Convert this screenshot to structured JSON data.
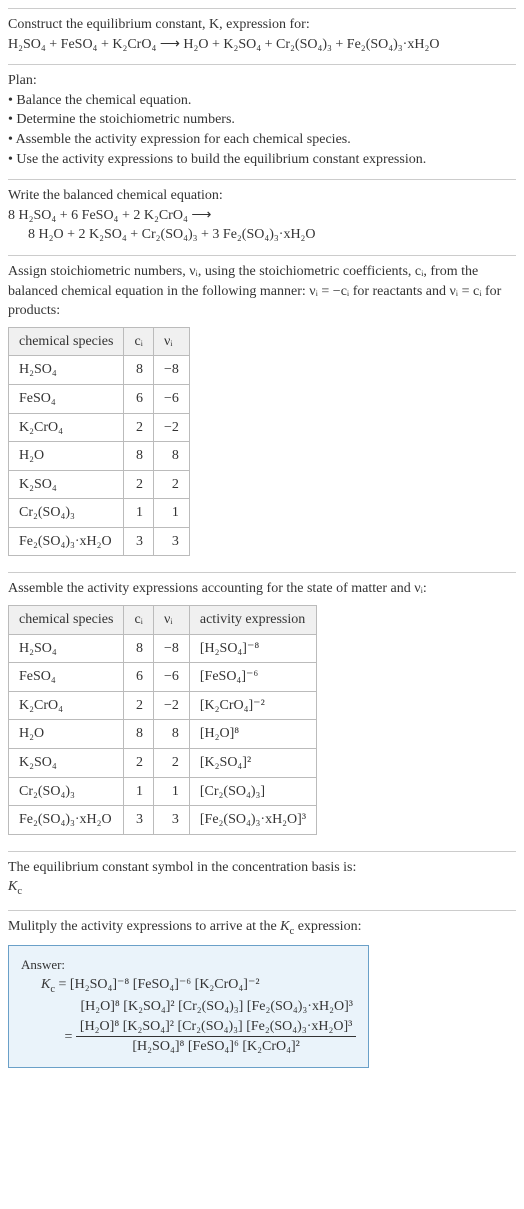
{
  "intro": {
    "line1": "Construct the equilibrium constant, K, expression for:",
    "equation": "H₂SO₄ + FeSO₄ + K₂CrO₄  ⟶  H₂O + K₂SO₄ + Cr₂(SO₄)₃ + Fe₂(SO₄)₃·xH₂O"
  },
  "plan": {
    "heading": "Plan:",
    "items": [
      "• Balance the chemical equation.",
      "• Determine the stoichiometric numbers.",
      "• Assemble the activity expression for each chemical species.",
      "• Use the activity expressions to build the equilibrium constant expression."
    ]
  },
  "balanced": {
    "heading": "Write the balanced chemical equation:",
    "line1": "8 H₂SO₄ + 6 FeSO₄ + 2 K₂CrO₄  ⟶",
    "line2": "8 H₂O + 2 K₂SO₄ + Cr₂(SO₄)₃ + 3 Fe₂(SO₄)₃·xH₂O"
  },
  "assign": {
    "paragraph": "Assign stoichiometric numbers, νᵢ, using the stoichiometric coefficients, cᵢ, from the balanced chemical equation in the following manner: νᵢ = −cᵢ for reactants and νᵢ = cᵢ for products:",
    "headers": {
      "species": "chemical species",
      "ci": "cᵢ",
      "vi": "νᵢ"
    },
    "rows": [
      {
        "species": "H₂SO₄",
        "ci": "8",
        "vi": "−8"
      },
      {
        "species": "FeSO₄",
        "ci": "6",
        "vi": "−6"
      },
      {
        "species": "K₂CrO₄",
        "ci": "2",
        "vi": "−2"
      },
      {
        "species": "H₂O",
        "ci": "8",
        "vi": "8"
      },
      {
        "species": "K₂SO₄",
        "ci": "2",
        "vi": "2"
      },
      {
        "species": "Cr₂(SO₄)₃",
        "ci": "1",
        "vi": "1"
      },
      {
        "species": "Fe₂(SO₄)₃·xH₂O",
        "ci": "3",
        "vi": "3"
      }
    ]
  },
  "activity": {
    "paragraph": "Assemble the activity expressions accounting for the state of matter and νᵢ:",
    "headers": {
      "species": "chemical species",
      "ci": "cᵢ",
      "vi": "νᵢ",
      "expr": "activity expression"
    },
    "rows": [
      {
        "species": "H₂SO₄",
        "ci": "8",
        "vi": "−8",
        "expr": "[H₂SO₄]⁻⁸"
      },
      {
        "species": "FeSO₄",
        "ci": "6",
        "vi": "−6",
        "expr": "[FeSO₄]⁻⁶"
      },
      {
        "species": "K₂CrO₄",
        "ci": "2",
        "vi": "−2",
        "expr": "[K₂CrO₄]⁻²"
      },
      {
        "species": "H₂O",
        "ci": "8",
        "vi": "8",
        "expr": "[H₂O]⁸"
      },
      {
        "species": "K₂SO₄",
        "ci": "2",
        "vi": "2",
        "expr": "[K₂SO₄]²"
      },
      {
        "species": "Cr₂(SO₄)₃",
        "ci": "1",
        "vi": "1",
        "expr": "[Cr₂(SO₄)₃]"
      },
      {
        "species": "Fe₂(SO₄)₃·xH₂O",
        "ci": "3",
        "vi": "3",
        "expr": "[Fe₂(SO₄)₃·xH₂O]³"
      }
    ]
  },
  "symbol": {
    "line1": "The equilibrium constant symbol in the concentration basis is:",
    "kc": "K_c"
  },
  "multiply": {
    "line1": "Mulitply the activity expressions to arrive at the K_c expression:"
  },
  "answer": {
    "label": "Answer:",
    "prefix": "K_c = ",
    "part1": "[H₂SO₄]⁻⁸ [FeSO₄]⁻⁶ [K₂CrO₄]⁻²",
    "part2": "[H₂O]⁸ [K₂SO₄]² [Cr₂(SO₄)₃] [Fe₂(SO₄)₃·xH₂O]³",
    "eq": "= ",
    "frac_num": "[H₂O]⁸ [K₂SO₄]² [Cr₂(SO₄)₃] [Fe₂(SO₄)₃·xH₂O]³",
    "frac_den": "[H₂SO₄]⁸ [FeSO₄]⁶ [K₂CrO₄]²"
  }
}
